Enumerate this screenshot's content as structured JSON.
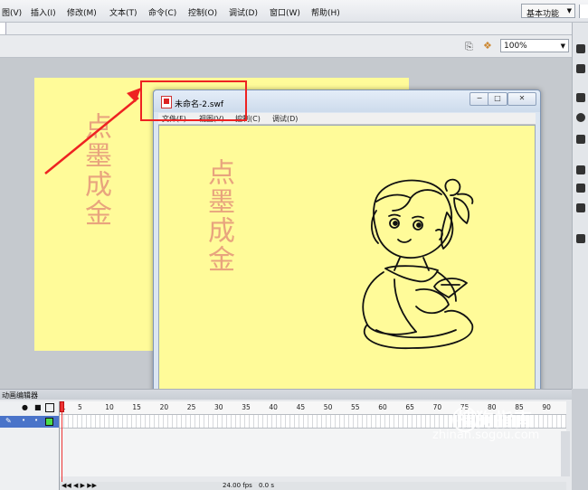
{
  "menu": {
    "items": [
      "图(V)",
      "插入(I)",
      "修改(M)",
      "文本(T)",
      "命令(C)",
      "控制(O)",
      "调试(D)",
      "窗口(W)",
      "帮助(H)"
    ],
    "workspace": "基本功能"
  },
  "toolbar": {
    "zoom": "100%"
  },
  "stage": {
    "text_chars": [
      "点",
      "墨",
      "成",
      "金"
    ]
  },
  "swf_window": {
    "title": "未命名-2.swf",
    "menu_items": [
      "文件(F)",
      "视图(V)",
      "控制(C)",
      "调试(D)"
    ],
    "buttons": {
      "minimize": "−",
      "maximize": "□",
      "close": "✕"
    },
    "content_chars": [
      "点",
      "墨",
      "成",
      "金"
    ]
  },
  "timeline": {
    "tab_label": "动画编辑器",
    "tick_labels": [
      "1",
      "5",
      "10",
      "15",
      "20",
      "25",
      "30",
      "35",
      "40",
      "45",
      "50",
      "55",
      "60",
      "65",
      "70",
      "75",
      "80",
      "85",
      "90"
    ],
    "footer_fps": "24.00 fps",
    "footer_time": "0.0 s"
  },
  "watermark": {
    "main": "搜狗指南",
    "url": "zhinan.sogou.com"
  },
  "colors": {
    "stage_bg": "#fffb99",
    "text_color": "#e8a47e",
    "highlight": "#e22222"
  },
  "icons": {
    "eye": "eye-icon",
    "lock": "lock-icon",
    "outline": "outline-icon",
    "pencil": "pencil-icon"
  }
}
